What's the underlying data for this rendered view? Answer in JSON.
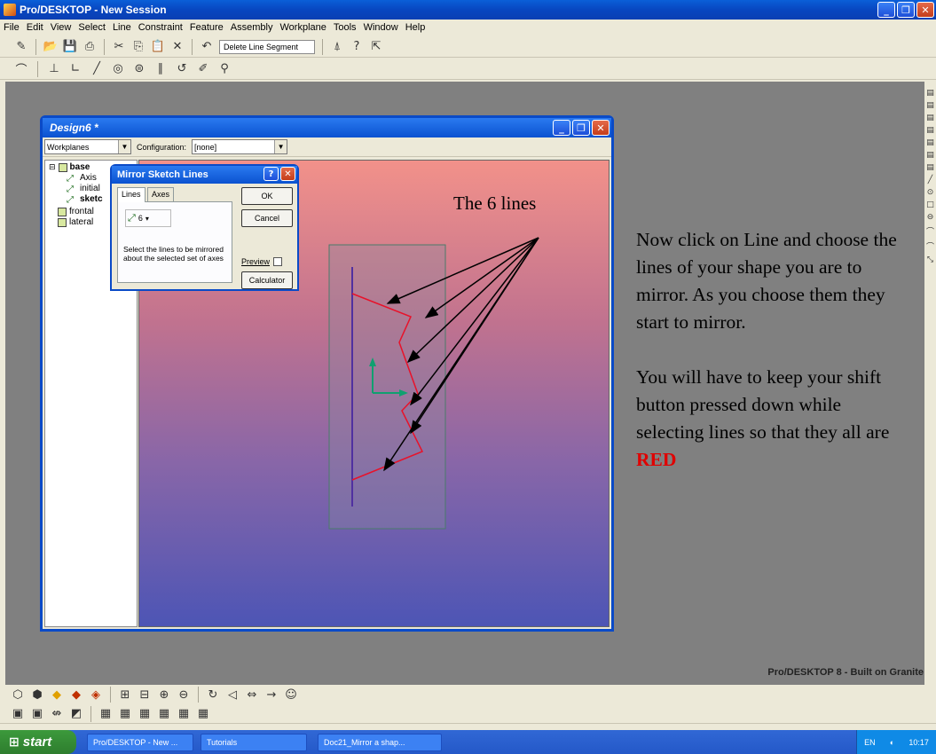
{
  "app": {
    "title": "Pro/DESKTOP - New Session",
    "branding": "Pro/DESKTOP 8 - Built on Granite"
  },
  "menu": [
    "File",
    "Edit",
    "View",
    "Select",
    "Line",
    "Constraint",
    "Feature",
    "Assembly",
    "Workplane",
    "Tools",
    "Window",
    "Help"
  ],
  "toolbar": {
    "undo_action": "Delete Line Segment"
  },
  "design_window": {
    "title": "Design6 *",
    "workplanes_select": "Workplanes",
    "configuration_label": "Configuration:",
    "configuration_value": "[none]",
    "tree": [
      "base",
      "Axis",
      "initial",
      "sketc",
      "frontal",
      "lateral"
    ]
  },
  "dialog": {
    "title": "Mirror Sketch Lines",
    "tabs": [
      "Lines",
      "Axes"
    ],
    "count": "6",
    "hint": "Select the lines to be mirrored about the selected set of axes",
    "ok": "OK",
    "cancel": "Cancel",
    "preview": "Preview",
    "calculator": "Calculator"
  },
  "annotation": {
    "label": "The 6 lines",
    "para1": "Now click on Line and choose the lines of your shape you are to mirror. As you choose them they start to mirror.",
    "para2_prefix": "You will have to keep your shift button pressed down while selecting lines so that they all are ",
    "para2_red": "RED"
  },
  "taskbar": {
    "start": "start",
    "tasks": [
      "Pro/DESKTOP - New ...",
      "Tutorials",
      "Doc21_Mirror a shap..."
    ],
    "lang": "EN",
    "time": "10:17"
  }
}
